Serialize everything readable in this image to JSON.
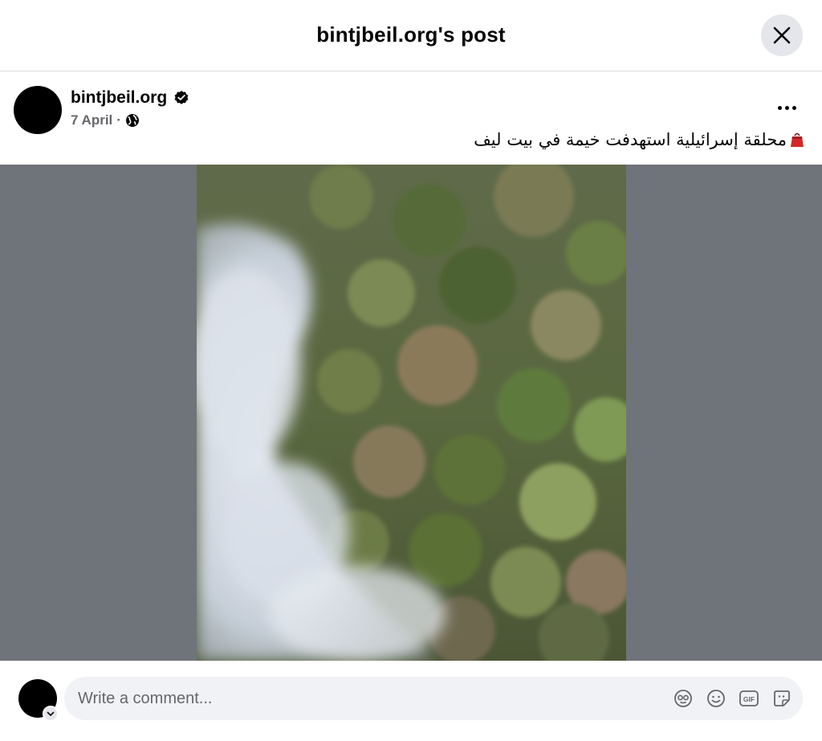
{
  "header": {
    "title": "bintjbeil.org's post",
    "close_icon": "close-icon"
  },
  "post": {
    "author": "bintjbeil.org",
    "verified": true,
    "date": "7 April",
    "separator": "·",
    "privacy_icon": "globe-icon",
    "text": "محلقة إسرائيلية استهدفت خيمة في بيت ليف",
    "text_emoji": "red-bag-emoji"
  },
  "composer": {
    "placeholder": "Write a comment...",
    "tools": [
      "avatar-sticker-icon",
      "emoji-icon",
      "gif-icon",
      "sticker-icon"
    ],
    "gif_label": "GIF"
  },
  "colors": {
    "media_bg": "#6f747a",
    "close_bg": "#e4e6eb",
    "input_bg": "#f0f2f5",
    "meta_text": "#65676b"
  }
}
